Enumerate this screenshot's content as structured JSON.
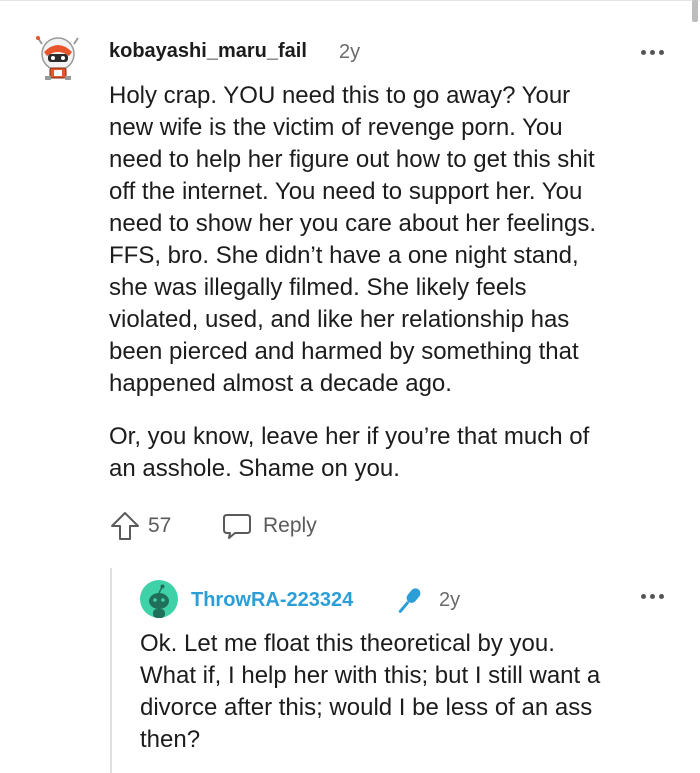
{
  "comment": {
    "author": "kobayashi_maru_fail",
    "age": "2y",
    "paragraphs": [
      [
        "Holy crap. YOU need this to go away? Your",
        "new wife is the victim of revenge porn. You",
        "need to help her figure out how to get this shit",
        "off the internet. You need to support her. You",
        "need to show her you care about her feelings.",
        "FFS, bro. She didn’t have a one night stand,",
        "she was illegally filmed. She likely feels",
        "violated, used, and like her relationship has",
        "been pierced and harmed by something that",
        "happened almost a decade ago."
      ],
      [
        "Or, you know, leave her if you’re that much of",
        "an asshole. Shame on you."
      ]
    ],
    "votes": "57",
    "reply_label": "Reply",
    "avatar_icon": "robot-avatar-icon",
    "more_icon": "more-options-icon"
  },
  "reply": {
    "author": "ThrowRA-223324",
    "author_color": "#2b9ed8",
    "badge_icon": "microphone-icon",
    "age": "2y",
    "paragraph": [
      "Ok. Let me float this theoretical by you.",
      "What if, I help her with this; but I still want a",
      "divorce after this; would I be less of an ass",
      "then?"
    ],
    "avatar_icon": "snoo-avatar-icon",
    "more_icon": "more-options-icon"
  }
}
